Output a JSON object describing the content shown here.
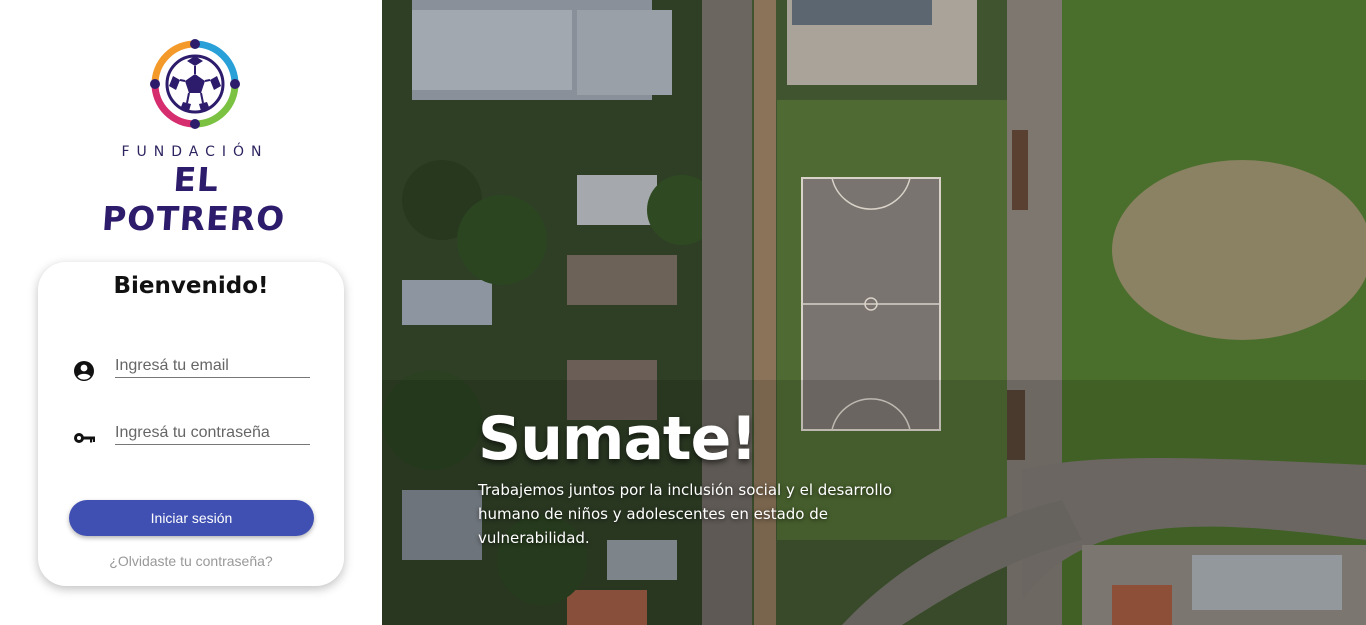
{
  "brand": {
    "line1": "FUNDACIÓN",
    "line2": "EL POTRERO",
    "colors": {
      "navy": "#2d1b6b",
      "blue": "#2aa0d8",
      "green": "#7cc242",
      "magenta": "#d62d6f",
      "orange": "#f39a2b"
    }
  },
  "login": {
    "title": "Bienvenido!",
    "email_placeholder": "Ingresá tu email",
    "email_value": "",
    "email_icon": "account-circle-icon",
    "password_placeholder": "Ingresá tu contraseña",
    "password_value": "",
    "password_icon": "key-icon",
    "submit_label": "Iniciar sesión",
    "forgot_label": "¿Olvidaste tu contraseña?",
    "button_color": "#3f4fb2"
  },
  "hero": {
    "headline": "Sumate!",
    "text": "Trabajemos juntos por la inclusión social y el desarrollo humano de niños y adolescentes en estado de vulnerabilidad."
  }
}
